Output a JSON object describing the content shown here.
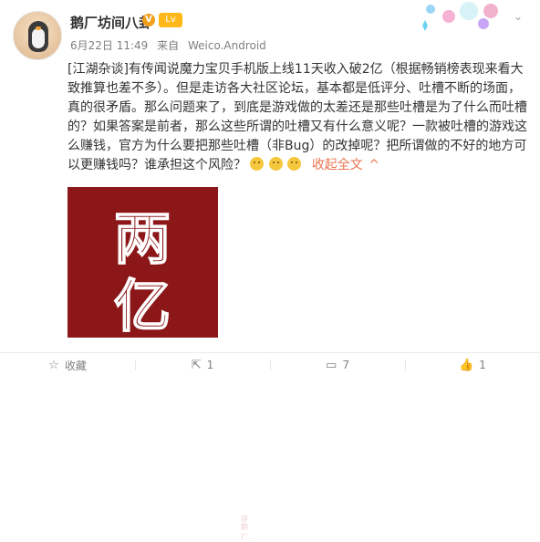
{
  "post": {
    "author": "鹅厂坊间八卦",
    "verified_badge": "V",
    "level_badge": "Lv",
    "date": "6月22日 11:49",
    "via_prefix": "来自",
    "client": "Weico.Android",
    "text": "[江湖杂谈]有传闻说魔力宝贝手机版上线11天收入破2亿（根据畅销榜表现来看大致推算也差不多）。但是走访各大社区论坛，基本都是低评分、吐槽不断的场面，真的很矛盾。那么问题来了，到底是游戏做的太差还是那些吐槽是为了什么而吐槽的？如果答案是前者，那么这些所谓的吐槽又有什么意义呢？一款被吐槽的游戏这么赚钱，官方为什么要把那些吐槽（非Bug）的改掉呢？把所谓做的不好的地方可以更赚钱吗？谁承担这个风险？",
    "expand_label": "收起全文",
    "expand_icon": "^",
    "image_text_1": "两",
    "image_text_2": "亿",
    "image_watermark": "@鹅厂..."
  },
  "actions": {
    "favorite_label": "收藏",
    "repost_count": "1",
    "comment_count": "7",
    "like_count": "1"
  },
  "colors": {
    "accent": "#eb7350",
    "image_bg": "#8c1719"
  }
}
